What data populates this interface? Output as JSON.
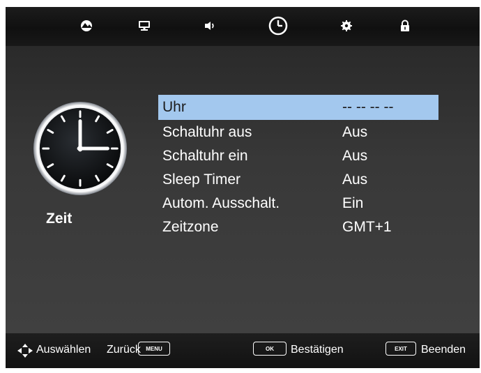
{
  "tabs": [
    {
      "icon": "picture-icon"
    },
    {
      "icon": "monitor-icon"
    },
    {
      "icon": "speaker-icon"
    },
    {
      "icon": "clock-icon",
      "active": true
    },
    {
      "icon": "gear-icon"
    },
    {
      "icon": "lock-icon"
    }
  ],
  "section": {
    "icon": "large-clock-icon",
    "title": "Zeit"
  },
  "menu": {
    "selected_color": "#a3c8ee",
    "items": [
      {
        "label": "Uhr",
        "value": "-- -- -- --",
        "selected": true
      },
      {
        "label": "Schaltuhr aus",
        "value": "Aus"
      },
      {
        "label": "Schaltuhr ein",
        "value": "Aus"
      },
      {
        "label": "Sleep Timer",
        "value": "Aus"
      },
      {
        "label": "Autom. Ausschalt.",
        "value": "Ein"
      },
      {
        "label": "Zeitzone",
        "value": "GMT+1"
      }
    ]
  },
  "footer": {
    "select_label": "Auswählen",
    "back_label": "Zurück",
    "menu_key": "MENU",
    "ok_key": "OK",
    "confirm_label": "Bestätigen",
    "exit_key": "EXIT",
    "exit_label": "Beenden"
  }
}
